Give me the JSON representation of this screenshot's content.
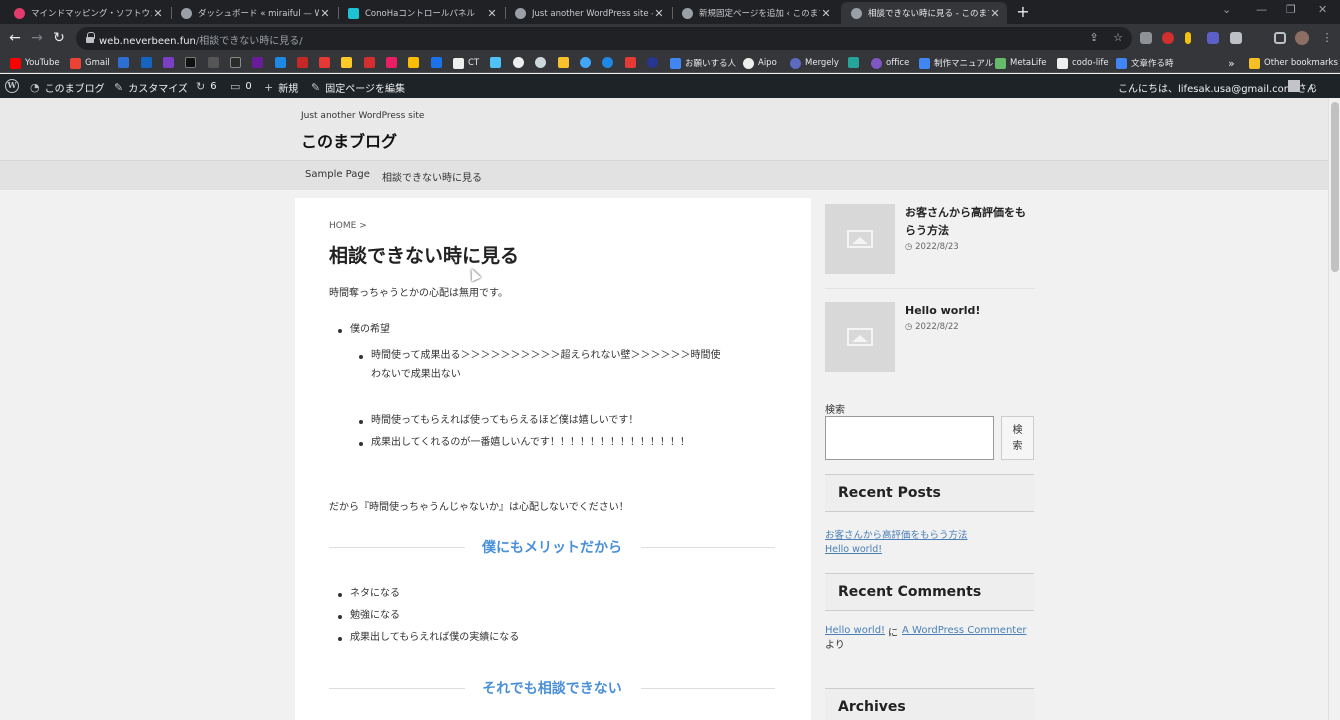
{
  "tabs": [
    {
      "title": "マインドマッピング・ソフトウェア - オンラ",
      "favicon_color": "#e23b6c",
      "active": false
    },
    {
      "title": "ダッシュボード « miraiful — WordPress",
      "favicon_color": "#9aa0a6",
      "active": false
    },
    {
      "title": "ConoHaコントロールパネル",
      "favicon_color": "#1ec2d3",
      "active": false
    },
    {
      "title": "Just another WordPress site - この",
      "favicon_color": "#9aa0a6",
      "active": false
    },
    {
      "title": "新規固定ページを追加 ‹ このまブログ",
      "favicon_color": "#9aa0a6",
      "active": false
    },
    {
      "title": "相談できない時に見る - このまブログ",
      "favicon_color": "#9aa0a6",
      "active": true
    }
  ],
  "address_bar": {
    "host": "web.neverbeen.fun",
    "path": "/相談できない時に見る/"
  },
  "bookmarks": {
    "youtube": "YouTube",
    "gmail": "Gmail",
    "ct": "CT",
    "onegai": "お願いする人",
    "aipo": "Aipo",
    "mergely": "Mergely",
    "office": "office",
    "manual": "制作マニュアル",
    "metalife": "MetaLife",
    "codolife": "codo-life",
    "bunsho": "文章作る時",
    "more": "»",
    "other": "Other bookmarks"
  },
  "admin_bar": {
    "site_name": "このまブログ",
    "customize": "カスタマイズ",
    "updates": "6",
    "comments": "0",
    "new": "新規",
    "edit_page": "固定ページを編集",
    "greeting": "こんにちは、lifesak.usa@gmail.com さん"
  },
  "site": {
    "tagline": "Just another WordPress site",
    "title": "このまブログ",
    "nav": [
      "Sample Page",
      "相談できない時に見る"
    ]
  },
  "post": {
    "breadcrumb_home": "HOME",
    "breadcrumb_sep": ">",
    "title": "相談できない時に見る",
    "intro": "時間奪っちゃうとかの心配は無用です。",
    "list_top": "僕の希望",
    "sub_item_1_line1": "時間使って成果出る＞＞＞＞＞＞＞＞＞＞超えられない壁＞＞＞＞＞＞時間使",
    "sub_item_1_line2": "わないで成果出ない",
    "sub_item_2": "時間使ってもらえれば使ってもらえるほど僕は嬉しいです！",
    "sub_item_3": "成果出してくれるのが一番嬉しいんです！！！！！！！！！！！！！！",
    "closing": "だから『時間使っちゃうんじゃないか』は心配しないでください！",
    "heading_1": "僕にもメリットだから",
    "merits": [
      "ネタになる",
      "勉強になる",
      "成果出してもらえれば僕の実績になる"
    ],
    "heading_2": "それでも相談できない"
  },
  "sidebar": {
    "popular": [
      {
        "title_line1": "お客さんから高評価をも",
        "title_line2": "らう方法",
        "date": "2022/8/23"
      },
      {
        "title_line1": "Hello world!",
        "title_line2": "",
        "date": "2022/8/22"
      }
    ],
    "search_label": "検索",
    "search_button_line1": "検",
    "search_button_line2": "索",
    "recent_posts_title": "Recent Posts",
    "recent_posts": [
      "お客さんから高評価をもらう方法",
      "Hello world!"
    ],
    "recent_comments_title": "Recent Comments",
    "comment_link": "Hello world!",
    "comment_on": "に",
    "commenter": "A WordPress Commenter",
    "comment_suffix": "より",
    "archives_title": "Archives"
  },
  "colors": {
    "heading_blue": "#4a90d9",
    "admin_bar_bg": "#1d2327",
    "link_blue": "#4a7fb5"
  }
}
